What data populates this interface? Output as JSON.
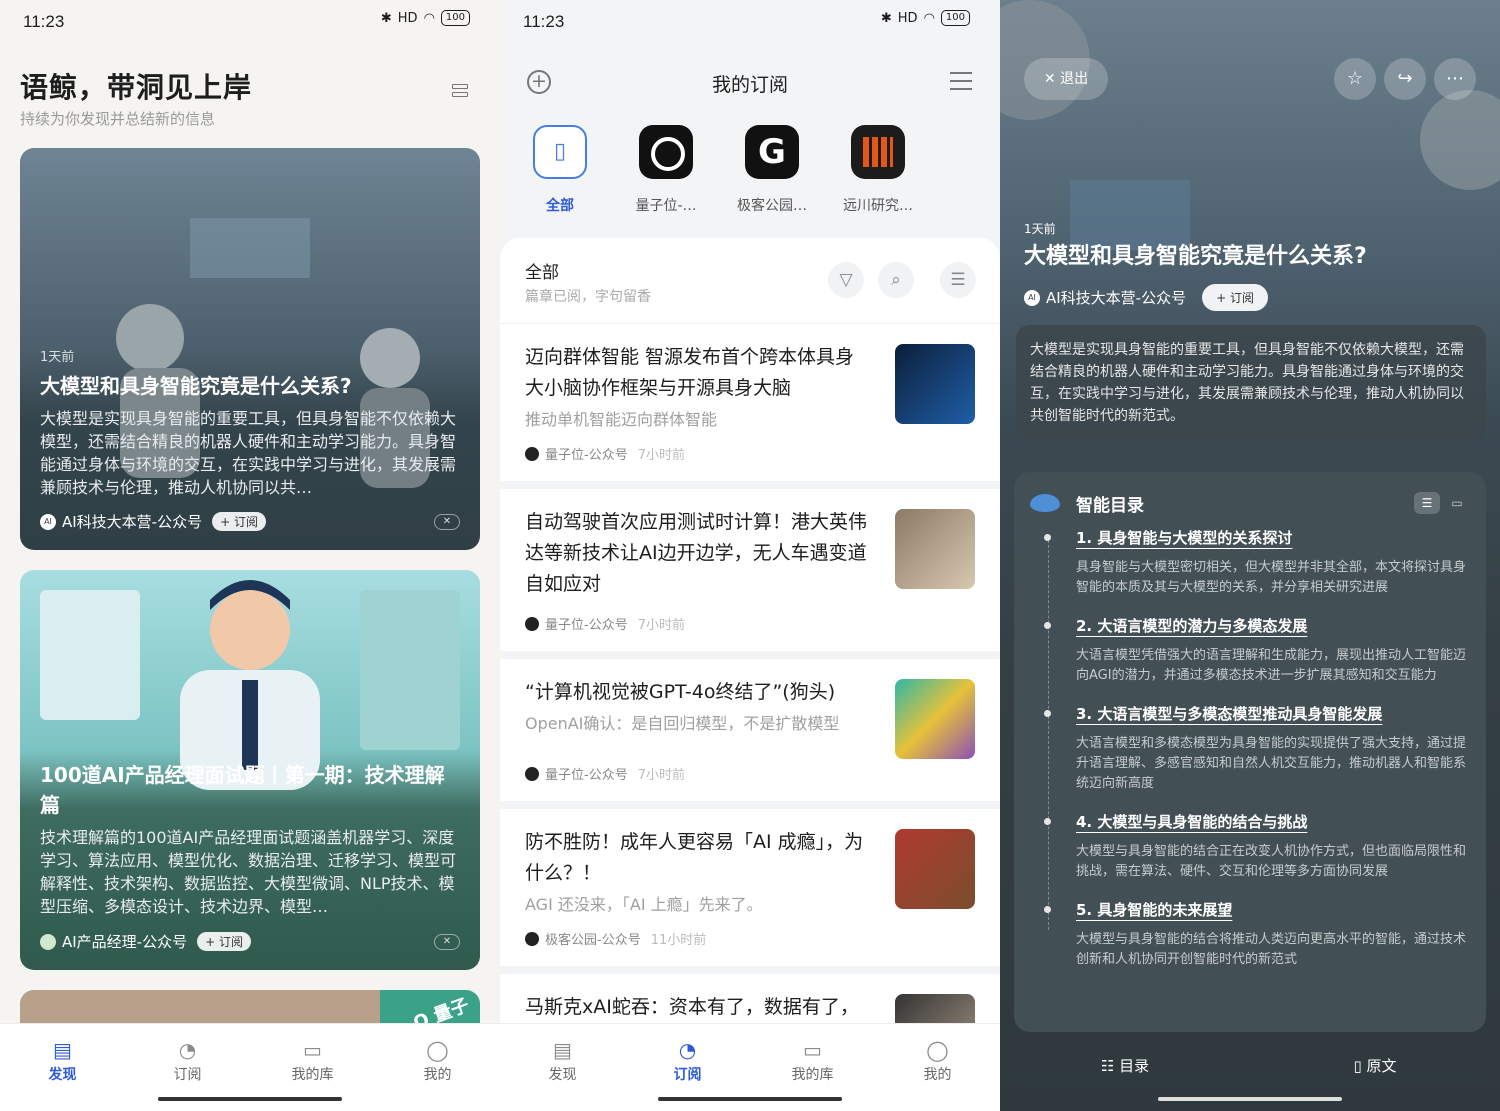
{
  "status": {
    "time": "11:23",
    "signal": "HD",
    "battery": "100"
  },
  "discover": {
    "title": "语鲸，带洞见上岸",
    "subtitle": "持续为你发现并总结新的信息",
    "cards": [
      {
        "age": "1天前",
        "title": "大模型和具身智能究竟是什么关系?",
        "body": "大模型是实现具身智能的重要工具，但具身智能不仅依赖大模型，还需结合精良的机器人硬件和主动学习能力。具身智能通过身体与环境的交互，在实践中学习与进化，其发展需兼顾技术与伦理，推动人机协同以共…",
        "source": "AI科技大本营-公众号",
        "subscribe": "+ 订阅"
      },
      {
        "title": "100道AI产品经理面试题丨第一期：技术理解篇",
        "body": "技术理解篇的100道AI产品经理面试题涵盖机器学习、深度学习、算法应用、模型优化、数据治理、迁移学习、模型可解释性、技术架构、数据监控、大模型微调、NLP技术、模型压缩、多模态设计、技术边界、模型…",
        "source": "AI产品经理-公众号",
        "subscribe": "+ 订阅"
      }
    ],
    "card3_badge": "Q 量子"
  },
  "nav": {
    "discover": "发现",
    "subscribe": "订阅",
    "library": "我的库",
    "me": "我的"
  },
  "subscriptions": {
    "title": "我的订阅",
    "sources": [
      "全部",
      "量子位-…",
      "极客公园…",
      "远川研究…"
    ],
    "feed_title": "全部",
    "feed_subtitle": "篇章已阅，字句留香",
    "articles": [
      {
        "title": "迈向群体智能 智源发布首个跨本体具身大小脑协作框架与开源具身大脑",
        "sub": "推动单机智能迈向群体智能",
        "source": "量子位-公众号",
        "time": "7小时前"
      },
      {
        "title": "自动驾驶首次应用测试时计算！港大英伟达等新技术让AI边开边学，无人车遇变道自如应对",
        "sub": "",
        "source": "量子位-公众号",
        "time": "7小时前"
      },
      {
        "title": "“计算机视觉被GPT-4o终结了”(狗头)",
        "sub": "OpenAI确认：是自回归模型，不是扩散模型",
        "source": "量子位-公众号",
        "time": "7小时前"
      },
      {
        "title": "防不胜防！成年人更容易「AI 成瘾」，为什么？！",
        "sub": "AGI 还没来，「AI 上瘾」先来了。",
        "source": "极客公园-公众号",
        "time": "11小时前"
      },
      {
        "title": "马斯克xAI蛇吞：资本有了，数据有了，商业模式也有了",
        "sub": "",
        "source": "",
        "time": ""
      }
    ]
  },
  "reader": {
    "exit": "退出",
    "age": "1天前",
    "title": "大模型和具身智能究竟是什么关系?",
    "source": "AI科技大本营-公众号",
    "subscribe": "+ 订阅",
    "summary": "大模型是实现具身智能的重要工具，但具身智能不仅依赖大模型，还需结合精良的机器人硬件和主动学习能力。具身智能通过身体与环境的交互，在实践中学习与进化，其发展需兼顾技术与伦理，推动人机协同以共创智能时代的新范式。",
    "toc_title": "智能目录",
    "toc": [
      {
        "h": "1. 具身智能与大模型的关系探讨",
        "d": "具身智能与大模型密切相关，但大模型并非其全部，本文将探讨具身智能的本质及其与大模型的关系，并分享相关研究进展"
      },
      {
        "h": "2. 大语言模型的潜力与多模态发展",
        "d": "大语言模型凭借强大的语言理解和生成能力，展现出推动人工智能迈向AGI的潜力，并通过多模态技术进一步扩展其感知和交互能力"
      },
      {
        "h": "3. 大语言模型与多模态模型推动具身智能发展",
        "d": "大语言模型和多模态模型为具身智能的实现提供了强大支持，通过提升语言理解、多感官感知和自然人机交互能力，推动机器人和智能系统迈向新高度"
      },
      {
        "h": "4. 大模型与具身智能的结合与挑战",
        "d": "大模型与具身智能的结合正在改变人机协作方式，但也面临局限性和挑战，需在算法、硬件、交互和伦理等多方面协同发展"
      },
      {
        "h": "5. 具身智能的未来展望",
        "d": "大模型与具身智能的结合将推动人类迈向更高水平的智能，通过技术创新和人机协同开创智能时代的新范式"
      }
    ],
    "btn_toc": "目录",
    "btn_original": "原文"
  },
  "colors": {
    "accent": "#2d5bd8",
    "reader_bg": "#3a4549"
  }
}
